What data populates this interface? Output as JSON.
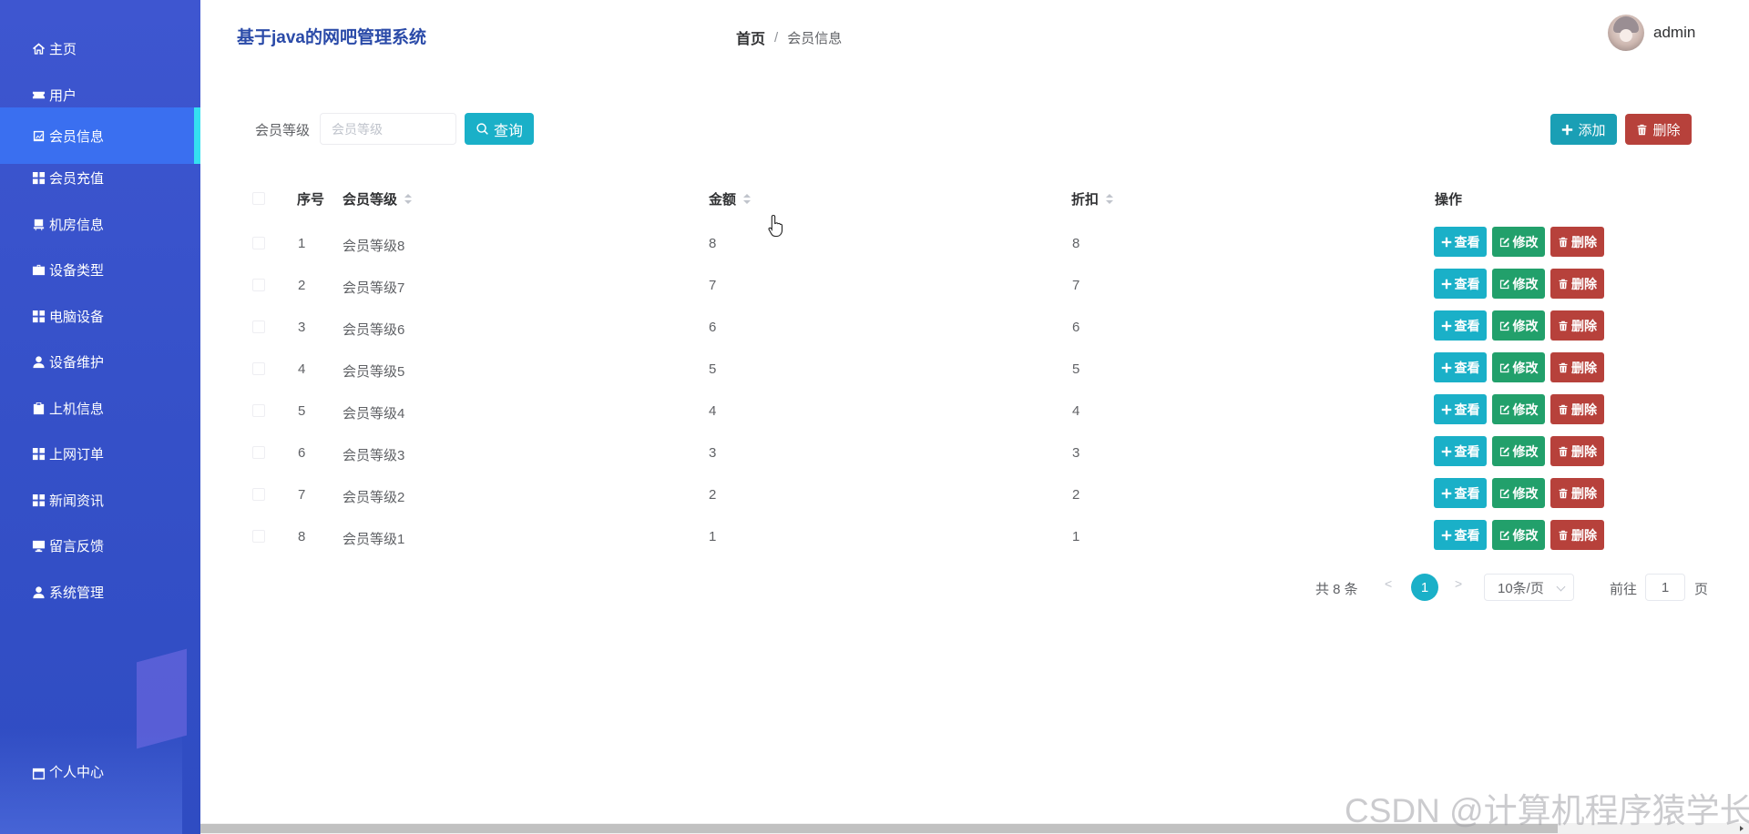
{
  "app": {
    "title": "基于java的网吧管理系统"
  },
  "breadcrumb": {
    "home": "首页",
    "separator": "/",
    "current": "会员信息"
  },
  "user": {
    "name": "admin"
  },
  "sidebar": {
    "items": [
      {
        "label": "主页",
        "icon": "home-icon"
      },
      {
        "label": "用户",
        "icon": "ticket-icon"
      },
      {
        "label": "会员信息",
        "icon": "chart-icon",
        "active": true
      },
      {
        "label": "会员充值",
        "icon": "grid-icon"
      },
      {
        "label": "机房信息",
        "icon": "chair-icon"
      },
      {
        "label": "设备类型",
        "icon": "briefcase-icon"
      },
      {
        "label": "电脑设备",
        "icon": "grid-icon"
      },
      {
        "label": "设备维护",
        "icon": "user-icon"
      },
      {
        "label": "上机信息",
        "icon": "clipboard-icon"
      },
      {
        "label": "上网订单",
        "icon": "grid-icon"
      },
      {
        "label": "新闻资讯",
        "icon": "grid-icon"
      },
      {
        "label": "留言反馈",
        "icon": "monitor-icon"
      },
      {
        "label": "系统管理",
        "icon": "user-icon"
      },
      {
        "label": "个人中心",
        "icon": "calendar-icon"
      }
    ]
  },
  "search": {
    "label": "会员等级",
    "placeholder": "会员等级",
    "value": "",
    "button": "查询"
  },
  "toolbar": {
    "add": "添加",
    "delete": "删除"
  },
  "table": {
    "columns": [
      "序号",
      "会员等级",
      "金额",
      "折扣",
      "操作"
    ],
    "rows": [
      {
        "index": "1",
        "level": "会员等级8",
        "amount": "8",
        "discount": "8"
      },
      {
        "index": "2",
        "level": "会员等级7",
        "amount": "7",
        "discount": "7"
      },
      {
        "index": "3",
        "level": "会员等级6",
        "amount": "6",
        "discount": "6"
      },
      {
        "index": "4",
        "level": "会员等级5",
        "amount": "5",
        "discount": "5"
      },
      {
        "index": "5",
        "level": "会员等级4",
        "amount": "4",
        "discount": "4"
      },
      {
        "index": "6",
        "level": "会员等级3",
        "amount": "3",
        "discount": "3"
      },
      {
        "index": "7",
        "level": "会员等级2",
        "amount": "2",
        "discount": "2"
      },
      {
        "index": "8",
        "level": "会员等级1",
        "amount": "1",
        "discount": "1"
      }
    ],
    "actions": {
      "view": "查看",
      "edit": "修改",
      "delete": "删除"
    }
  },
  "pagination": {
    "total": "共 8 条",
    "prev": "<",
    "current": "1",
    "next": ">",
    "page_size": "10条/页",
    "goto_label": "前往",
    "goto_value": "1",
    "page_suffix": "页"
  },
  "watermark": "CSDN @计算机程序猿学长",
  "colors": {
    "sidebar": "#3651c9",
    "sidebar_active": "#3a6ff0",
    "active_indicator": "#35e0f0",
    "primary": "#1ab0c8",
    "success": "#22a06b",
    "danger": "#b7413b",
    "title": "#2a4aa8"
  }
}
